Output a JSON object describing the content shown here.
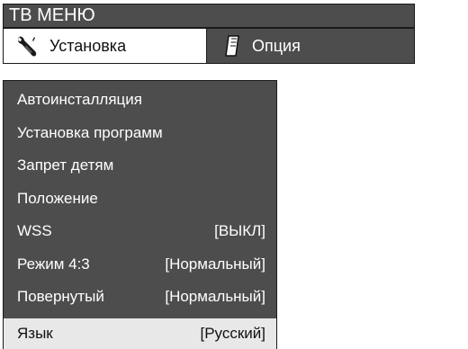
{
  "window": {
    "title": "ТВ МЕНЮ"
  },
  "tabs": [
    {
      "label": "Установка",
      "icon": "wrench-icon",
      "active": true
    },
    {
      "label": "Опция",
      "icon": "document-icon",
      "active": false
    }
  ],
  "menu": {
    "items": [
      {
        "label": "Автоинсталляция",
        "value": ""
      },
      {
        "label": "Установка программ",
        "value": ""
      },
      {
        "label": "Запрет детям",
        "value": ""
      },
      {
        "label": "Положение",
        "value": ""
      },
      {
        "label": "WSS",
        "value": "[ВЫКЛ]"
      },
      {
        "label": "Режим 4:3",
        "value": "[Нормальный]"
      },
      {
        "label": "Повернутый",
        "value": "[Нормальный]"
      },
      {
        "label": "Язык",
        "value": "[Русский]",
        "selected": true
      }
    ]
  },
  "colors": {
    "panel": "#4d4d4d",
    "selected_row": "#e8e8e8",
    "text_light": "#ffffff",
    "text_dark": "#111111"
  }
}
